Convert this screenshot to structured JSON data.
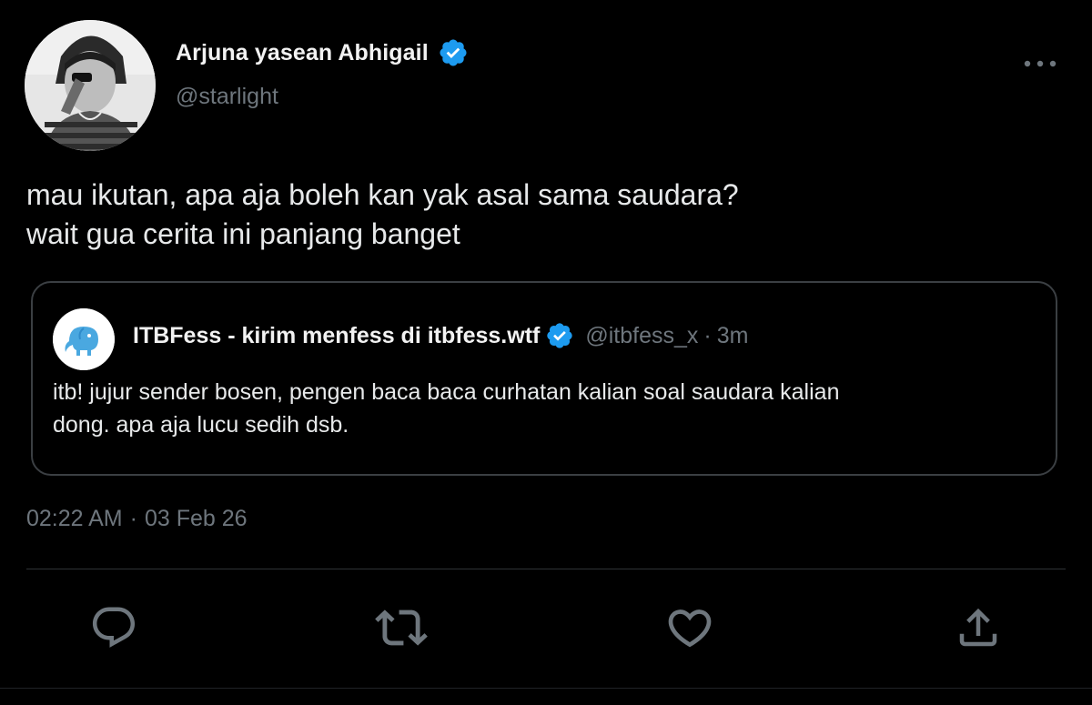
{
  "author": {
    "name": "Arjuna yasean Abhigail",
    "handle": "@starlight",
    "verified": true
  },
  "tweet": {
    "lines": [
      "mau ikutan, apa aja boleh kan yak asal sama saudara?",
      "wait gua cerita ini panjang banget"
    ],
    "time": "02:22 AM",
    "separator": "·",
    "date": "03 Feb 26"
  },
  "quote": {
    "name": "ITBFess - kirim menfess di itbfess.wtf",
    "handle": "@itbfess_x",
    "separator": "·",
    "time": "3m",
    "verified": true,
    "lines": [
      "itb! jujur sender bosen, pengen baca baca curhatan kalian soal saudara kalian",
      "dong. apa aja lucu sedih dsb."
    ]
  },
  "actions": [
    {
      "icon": "reply-icon"
    },
    {
      "icon": "retweet-icon"
    },
    {
      "icon": "like-icon"
    },
    {
      "icon": "share-icon"
    }
  ],
  "colors": {
    "background": "#000000",
    "text": "#e7e9ea",
    "muted": "#6e767d",
    "accent": "#1d9bf0",
    "border": "#3b3f43"
  }
}
